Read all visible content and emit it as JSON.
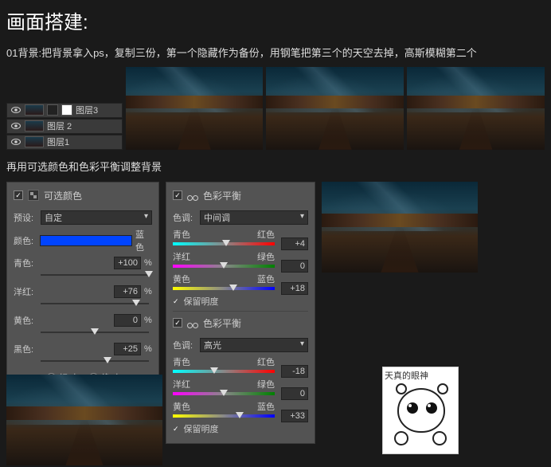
{
  "title": "画面搭建:",
  "intro": "01背景:把背景拿入ps，复制三份，第一个隐藏作为备份，用钢笔把第三个的天空去掉，高斯模糊第二个",
  "layers": [
    {
      "name": "图层3",
      "hasMask": true
    },
    {
      "name": "图层 2",
      "hasMask": false
    },
    {
      "name": "图层1",
      "hasMask": false
    }
  ],
  "sub": "再用可选颜色和色彩平衡调整背景",
  "selColor": {
    "title": "可选颜色",
    "presetLabel": "预设:",
    "preset": "自定",
    "colorLabel": "颜色:",
    "colorName": "蓝色",
    "rows": [
      {
        "label": "青色:",
        "val": "+100",
        "knob": 100
      },
      {
        "label": "洋红:",
        "val": "+76",
        "knob": 88
      },
      {
        "label": "黄色:",
        "val": "0",
        "knob": 50
      },
      {
        "label": "黑色:",
        "val": "+25",
        "knob": 62
      }
    ],
    "pct": "%",
    "radio1": "相对",
    "radio2": "绝对"
  },
  "bal1": {
    "title": "色彩平衡",
    "toneLabel": "色调:",
    "tone": "中间调",
    "rows": [
      {
        "l": "青色",
        "r": "红色",
        "v": "+4",
        "k": 52
      },
      {
        "l": "洋红",
        "r": "绿色",
        "v": "0",
        "k": 50
      },
      {
        "l": "黄色",
        "r": "蓝色",
        "v": "+18",
        "k": 59
      }
    ],
    "preserve": "保留明度"
  },
  "bal2": {
    "title": "色彩平衡",
    "toneLabel": "色调:",
    "tone": "高光",
    "rows": [
      {
        "l": "青色",
        "r": "红色",
        "v": "-18",
        "k": 41
      },
      {
        "l": "洋红",
        "r": "绿色",
        "v": "0",
        "k": 50
      },
      {
        "l": "黄色",
        "r": "蓝色",
        "v": "+33",
        "k": 66
      }
    ],
    "preserve": "保留明度"
  },
  "cartoon": "天真的眼神"
}
